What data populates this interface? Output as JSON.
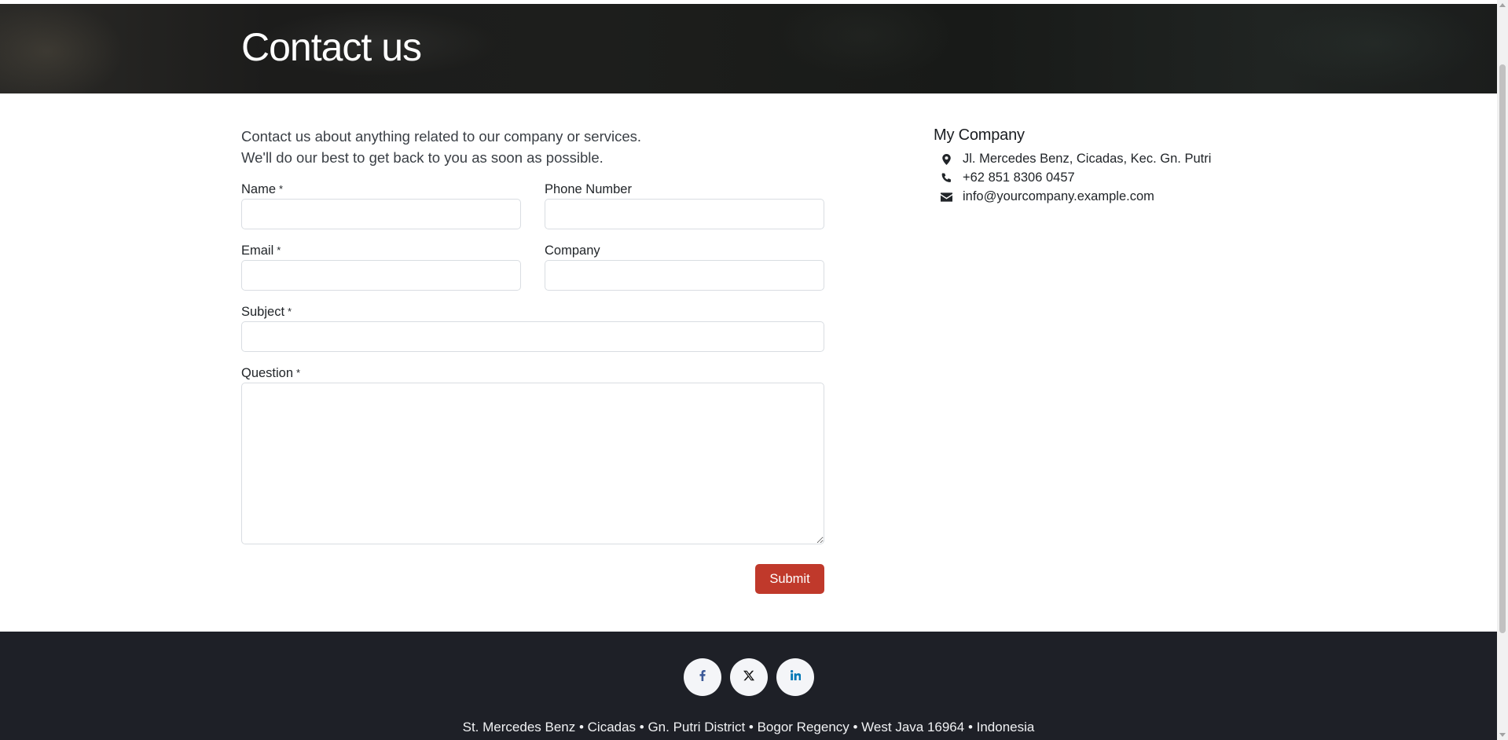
{
  "hero": {
    "title": "Contact us"
  },
  "intro": {
    "line1": "Contact us about anything related to our company or services.",
    "line2": "We'll do our best to get back to you as soon as possible."
  },
  "form": {
    "required_marker": "*",
    "name_label": "Name",
    "name_value": "",
    "phone_label": "Phone Number",
    "phone_value": "",
    "email_label": "Email",
    "email_value": "",
    "company_label": "Company",
    "company_value": "",
    "subject_label": "Subject",
    "subject_value": "",
    "question_label": "Question",
    "question_value": "",
    "submit_label": "Submit"
  },
  "company": {
    "name": "My Company",
    "address": "Jl. Mercedes Benz, Cicadas, Kec. Gn. Putri",
    "phone": "+62 851 8306 0457",
    "email": "info@yourcompany.example.com",
    "icons": [
      "map-marker-icon",
      "phone-icon",
      "envelope-icon"
    ]
  },
  "footer": {
    "social_icons": [
      "facebook-icon",
      "x-twitter-icon",
      "linkedin-icon"
    ],
    "address": "St. Mercedes Benz • Cicadas • Gn. Putri District • Bogor Regency • West Java 16964 • Indonesia"
  },
  "colors": {
    "accent": "#c0392b",
    "footer_bg": "#1e2027",
    "facebook": "#3b5998",
    "linkedin": "#0077b5"
  }
}
